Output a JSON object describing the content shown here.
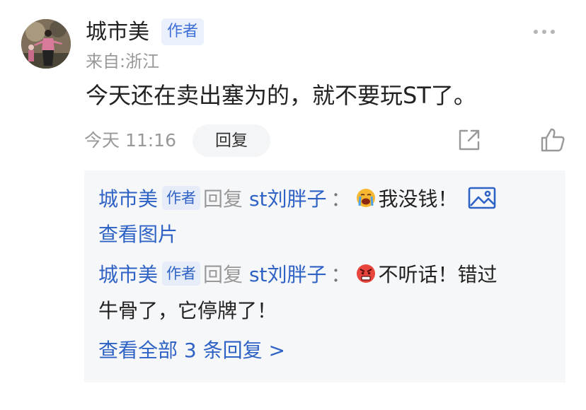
{
  "post": {
    "username": "城市美",
    "author_badge": "作者",
    "location": "来自:浙江",
    "content": "今天还在卖出塞为的，就不要玩ST了。",
    "time": "今天 11:16",
    "reply_label": "回复",
    "icons": [
      "more-icon",
      "share-icon",
      "like-icon"
    ]
  },
  "replies": [
    {
      "author": "城市美",
      "badge": "作者",
      "reply_word": "回复",
      "target": "st刘胖子",
      "colon": "：",
      "emoji": "crying-face-emoji",
      "text": "我没钱！",
      "view_image": "查看图片"
    },
    {
      "author": "城市美",
      "badge": "作者",
      "reply_word": "回复",
      "target": "st刘胖子",
      "colon": "：",
      "emoji": "angry-face-emoji",
      "text_line1": "不听话！错过",
      "text_line2": "牛骨了，它停牌了！"
    }
  ],
  "view_all": "查看全部 3 条回复 >",
  "colors": {
    "link_blue": "#2f62c5",
    "badge_bg": "#eaf1fd",
    "meta_grey": "#999999",
    "reply_bg": "#f6f7f9"
  }
}
